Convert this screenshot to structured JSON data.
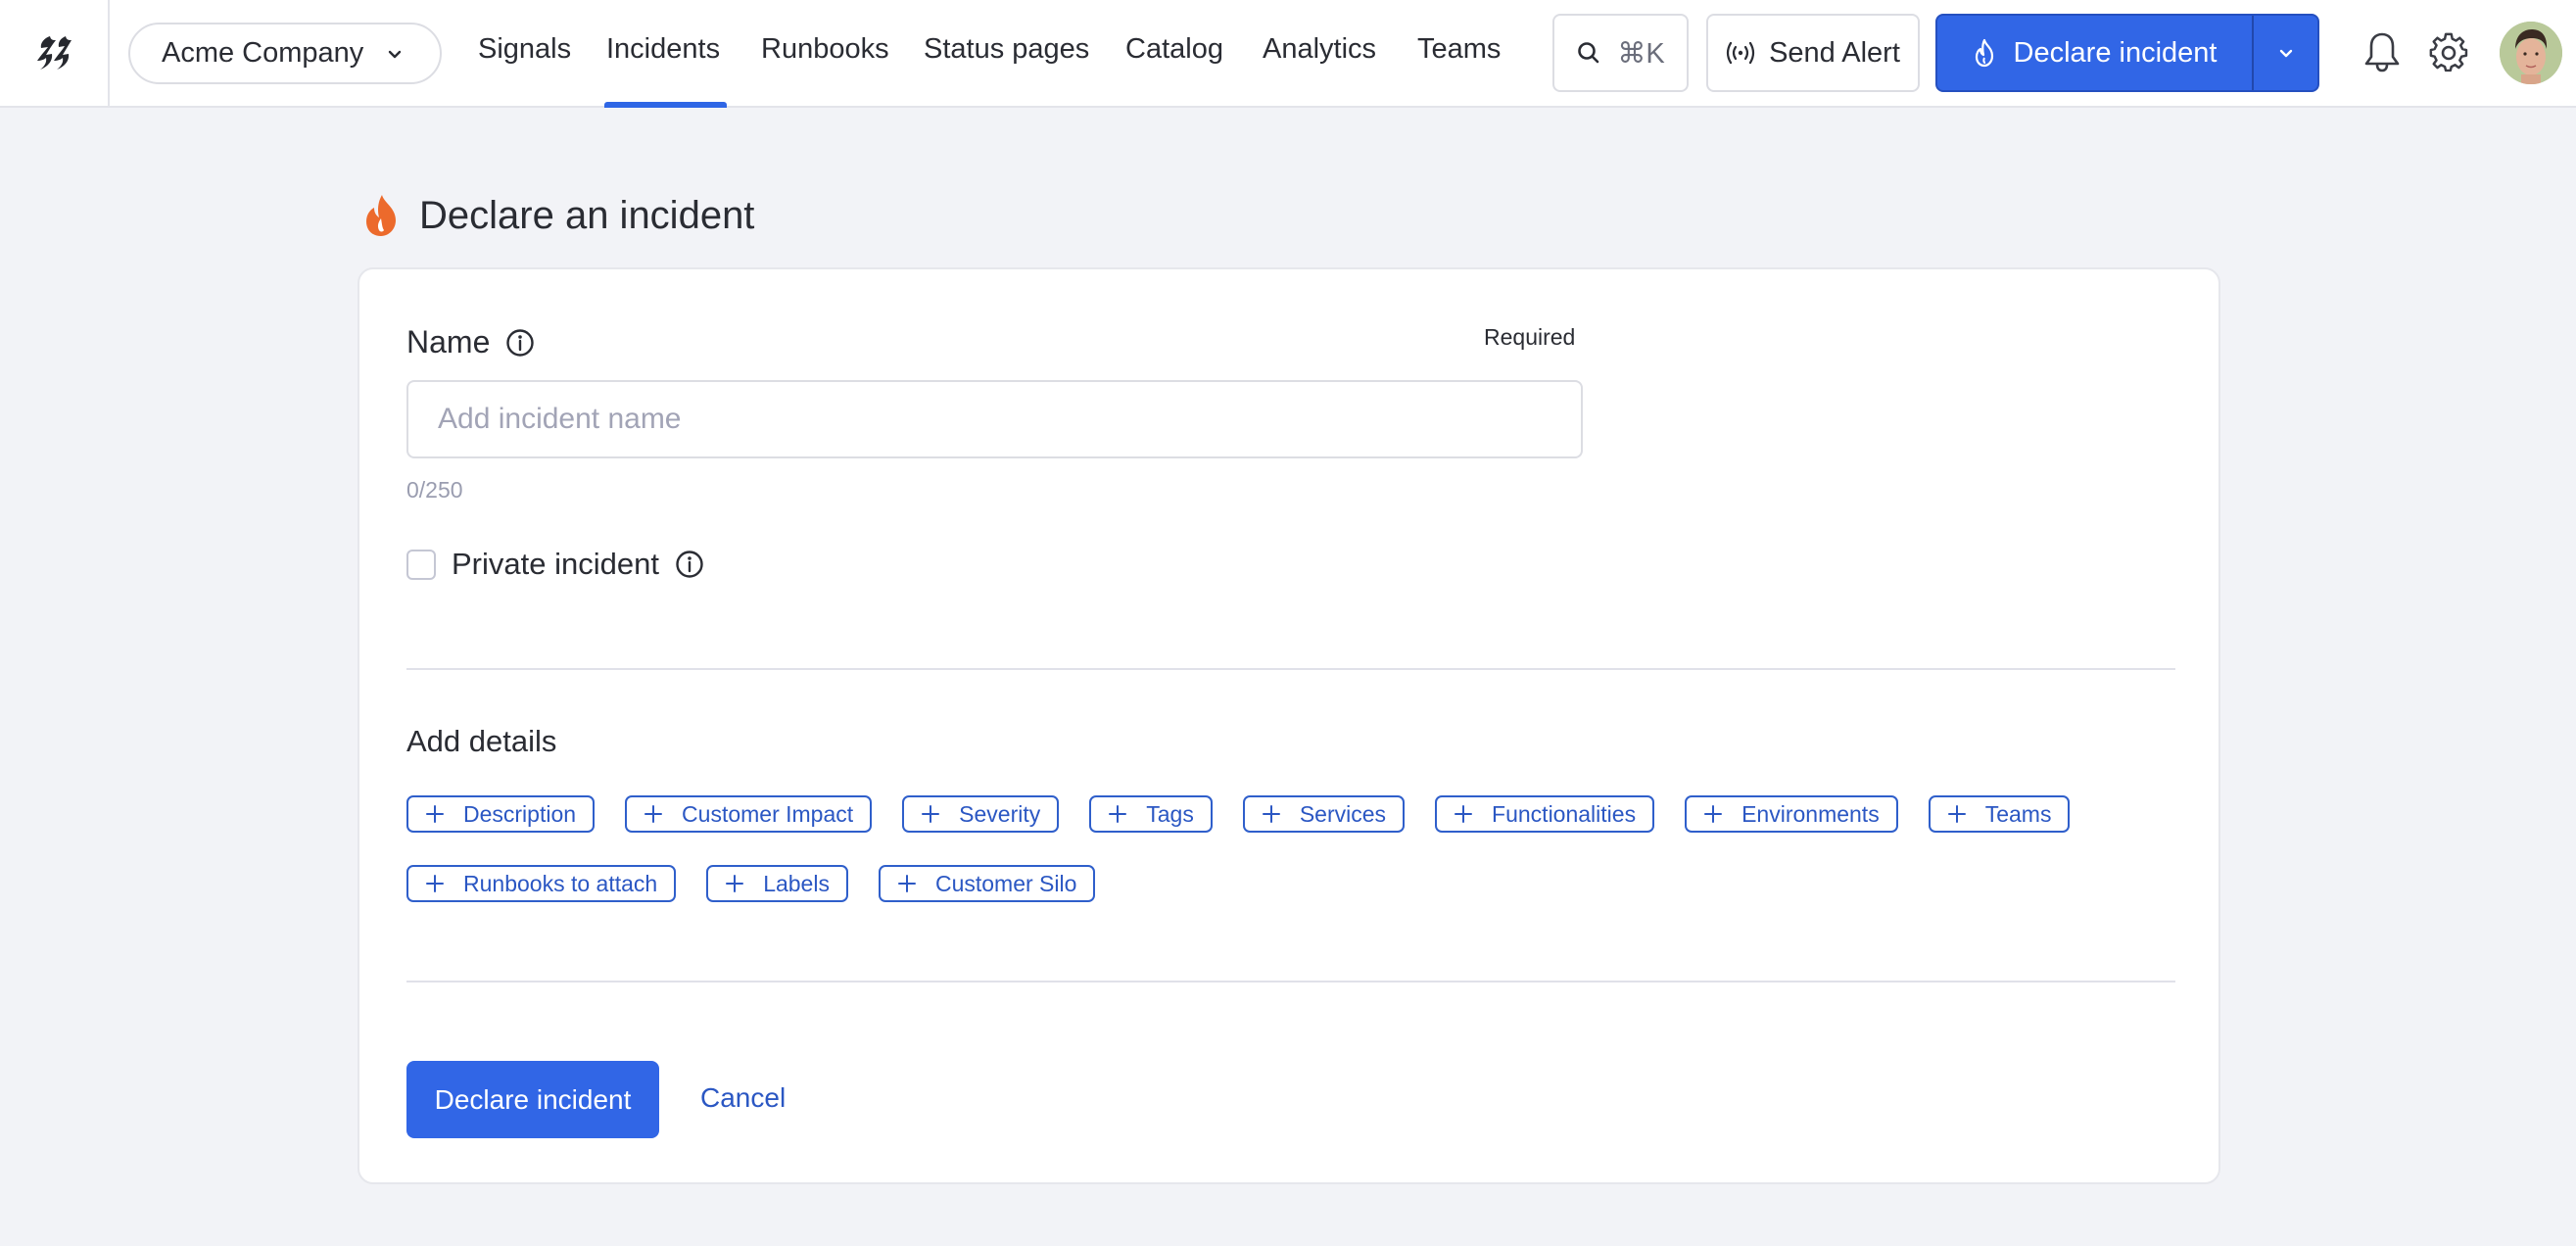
{
  "nav": {
    "logo": "firehydrant-logo-icon",
    "company": "Acme Company",
    "items": [
      {
        "label": "Signals",
        "active": false
      },
      {
        "label": "Incidents",
        "active": true
      },
      {
        "label": "Runbooks",
        "active": false
      },
      {
        "label": "Status pages",
        "active": false
      },
      {
        "label": "Catalog",
        "active": false
      },
      {
        "label": "Analytics",
        "active": false
      },
      {
        "label": "Teams",
        "active": false
      }
    ],
    "search_shortcut": "⌘K",
    "send_alert_label": "Send Alert",
    "declare_label": "Declare incident",
    "icons": [
      "search-icon",
      "broadcast-icon",
      "flame-icon",
      "chevron-down-icon",
      "bell-icon",
      "gear-icon",
      "avatar"
    ]
  },
  "page": {
    "title": "Declare an incident",
    "name_label": "Name",
    "required_label": "Required",
    "name_value": "",
    "name_placeholder": "Add incident name",
    "char_count": "0/250",
    "private_label": "Private incident",
    "private_checked": false,
    "details_title": "Add details",
    "detail_chips": [
      "Description",
      "Customer Impact",
      "Severity",
      "Tags",
      "Services",
      "Functionalities",
      "Environments",
      "Teams",
      "Runbooks to attach",
      "Labels",
      "Customer Silo"
    ],
    "submit_label": "Declare incident",
    "cancel_label": "Cancel"
  },
  "colors": {
    "primary": "#3166e6",
    "link": "#2b57c3",
    "flame": "#ec6a2c",
    "background": "#f2f3f7"
  }
}
